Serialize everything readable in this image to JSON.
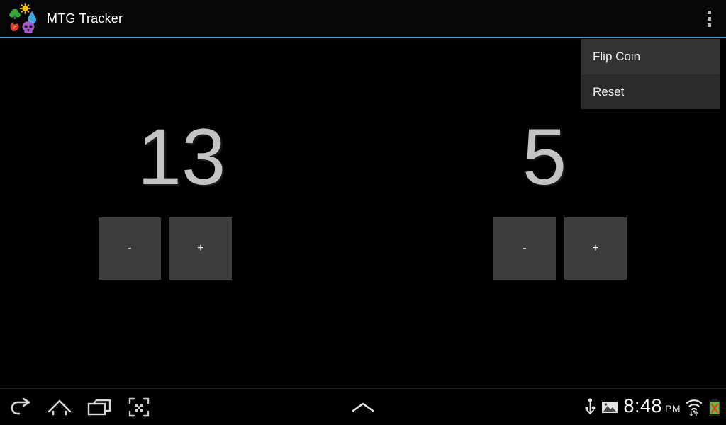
{
  "app": {
    "title": "MTG Tracker",
    "icon_name": "mtg-mana-symbols-icon",
    "accent_color": "#4eaad4",
    "background_color": "#000000"
  },
  "action_bar": {
    "overflow_icon": "overflow-menu-icon"
  },
  "overflow_menu": {
    "items": [
      {
        "label": "Flip Coin",
        "name": "menu-item-flip-coin"
      },
      {
        "label": "Reset",
        "name": "menu-item-reset"
      }
    ]
  },
  "players": [
    {
      "name": "player-one",
      "life_total": "13",
      "decrement_label": "-",
      "increment_label": "+"
    },
    {
      "name": "player-two",
      "life_total": "5",
      "decrement_label": "-",
      "increment_label": "+"
    }
  ],
  "nav_bar": {
    "back_icon": "back-arrow-icon",
    "home_icon": "home-icon",
    "recents_icon": "recent-apps-icon",
    "screenshot_icon": "screenshot-icon",
    "caret_icon": "chevron-up-icon"
  },
  "status_bar": {
    "usb_icon": "usb-icon",
    "screenshot_icon": "image-icon",
    "time": "8:48",
    "meridiem": "PM",
    "wifi_icon": "wifi-data-icon",
    "battery_icon": "battery-error-icon",
    "battery_color": "#62bb46",
    "battery_error_color": "#d84a1b"
  }
}
